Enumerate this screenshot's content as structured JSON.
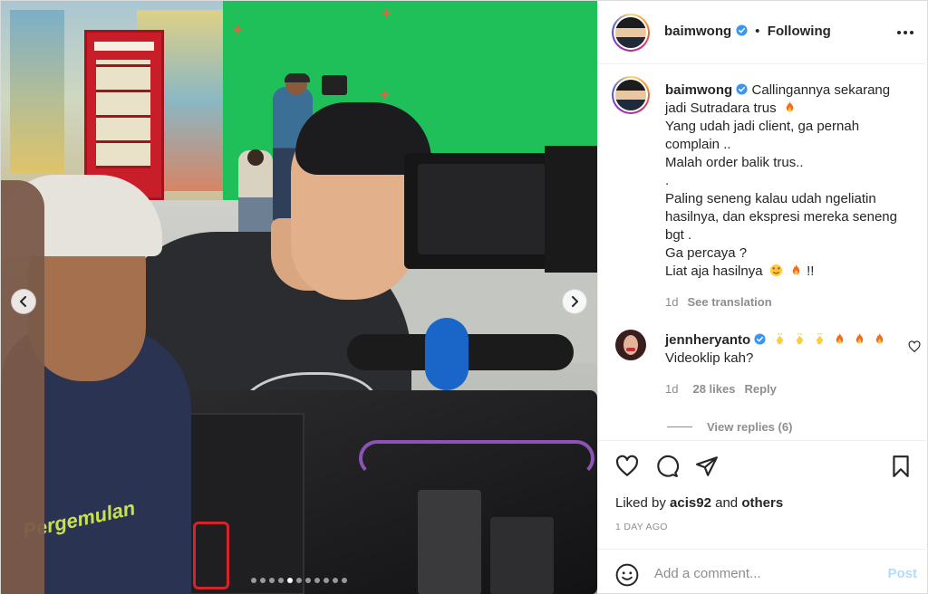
{
  "post": {
    "author": "baimwong",
    "follow_status": "Following",
    "separator": "•",
    "media": {
      "dot_count": 11,
      "active_dot": 4,
      "shirt_print": "Pergemulan"
    },
    "caption": {
      "username": "baimwong",
      "lines": [
        "Callingannya sekarang jadi Sutradara trus",
        "Yang udah jadi client, ga pernah complain ..",
        "Malah order balik trus..",
        ".",
        "Paling seneng kalau udah ngeliatin hasilnya, dan ekspresi mereka seneng bgt .",
        "Ga percaya ?",
        "Liat aja hasilnya",
        "!!"
      ],
      "age": "1d",
      "see_translation": "See translation"
    },
    "comment": {
      "username": "jennheryanto",
      "text": "Videoklip kah?",
      "age": "1d",
      "likes": "28 likes",
      "reply": "Reply",
      "view_replies": "View replies (6)"
    },
    "likes": {
      "prefix": "Liked by",
      "user": "acis92",
      "connector": "and",
      "others": "others"
    },
    "date": "1 DAY AGO",
    "add_comment": {
      "placeholder": "Add a comment...",
      "post_label": "Post"
    }
  },
  "icons": {
    "verified": "verified-badge-icon",
    "more": "more-options-icon",
    "like": "heart-icon",
    "comment": "comment-icon",
    "share": "paper-plane-icon",
    "save": "bookmark-icon",
    "emoji": "smiley-icon",
    "prev": "chevron-left-icon",
    "next": "chevron-right-icon"
  },
  "colors": {
    "verified_blue": "#3897f0",
    "text": "#262626",
    "muted": "#8e8e8e",
    "post_disabled": "#b3dbff",
    "green_screen": "#1fbf5a"
  }
}
